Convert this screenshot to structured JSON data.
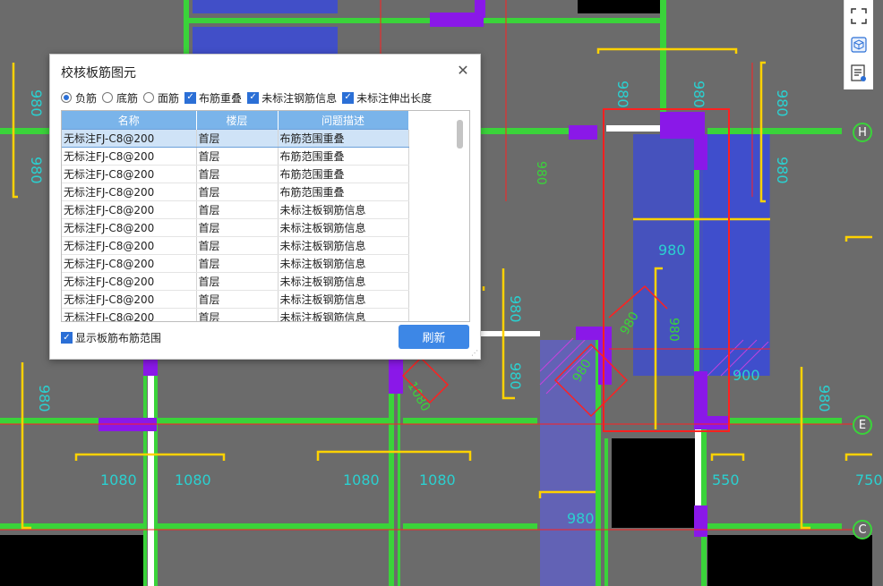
{
  "dialog": {
    "title": "校核板筋图元",
    "close_icon": "close-icon",
    "filters": {
      "radios": [
        {
          "label": "负筋",
          "checked": true
        },
        {
          "label": "底筋",
          "checked": false
        },
        {
          "label": "面筋",
          "checked": false
        }
      ],
      "checks": [
        {
          "label": "布筋重叠",
          "checked": true
        },
        {
          "label": "未标注钢筋信息",
          "checked": true
        },
        {
          "label": "未标注伸出长度",
          "checked": true
        }
      ]
    },
    "table": {
      "headers": [
        "名称",
        "楼层",
        "问题描述"
      ],
      "rows": [
        [
          "无标注FJ-C8@200",
          "首层",
          "布筋范围重叠"
        ],
        [
          "无标注FJ-C8@200",
          "首层",
          "布筋范围重叠"
        ],
        [
          "无标注FJ-C8@200",
          "首层",
          "布筋范围重叠"
        ],
        [
          "无标注FJ-C8@200",
          "首层",
          "布筋范围重叠"
        ],
        [
          "无标注FJ-C8@200",
          "首层",
          "未标注板钢筋信息"
        ],
        [
          "无标注FJ-C8@200",
          "首层",
          "未标注板钢筋信息"
        ],
        [
          "无标注FJ-C8@200",
          "首层",
          "未标注板钢筋信息"
        ],
        [
          "无标注FJ-C8@200",
          "首层",
          "未标注板钢筋信息"
        ],
        [
          "无标注FJ-C8@200",
          "首层",
          "未标注板钢筋信息"
        ],
        [
          "无标注FJ-C8@200",
          "首层",
          "未标注板钢筋信息"
        ],
        [
          "无标注FJ-C8@200",
          "首层",
          "未标注板钢筋信息"
        ]
      ],
      "selected_row": 0
    },
    "show_range": {
      "label": "显示板筋布筋范围",
      "checked": true
    },
    "refresh_label": "刷新"
  },
  "toolbar": {
    "icons": [
      "fullscreen-icon",
      "cube-view-icon",
      "list-view-icon"
    ]
  },
  "axis_labels": {
    "h": "H",
    "e": "E",
    "c": "C"
  },
  "drawing_labels": {
    "dims": [
      "980",
      "980",
      "980",
      "980",
      "980",
      "980",
      "980",
      "980",
      "980",
      "980",
      "980",
      "980",
      "1080",
      "1080",
      "1080",
      "1080",
      "1080",
      "550",
      "750",
      "900",
      "980",
      "980",
      "980",
      "980",
      "1080",
      "980",
      "980"
    ]
  },
  "colors": {
    "background": "#6b6b6b",
    "wall_green": "#3ad33a",
    "rebar_yellow": "#ffd200",
    "slab_blue": "#3a4ad8",
    "column_purple": "#8a18e8",
    "selection_red": "#ff2020",
    "accent": "#2b6fd6"
  }
}
